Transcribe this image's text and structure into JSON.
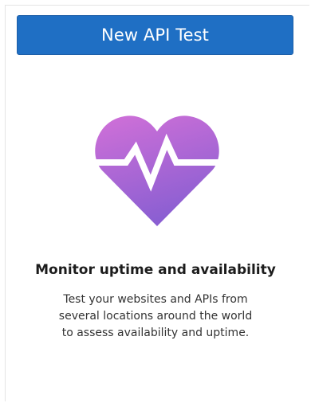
{
  "card": {
    "button_label": "New API Test",
    "icon": "heart-pulse-icon",
    "headline": "Monitor uptime and availability",
    "description_lines": [
      "Test your websites and APIs from",
      "several locations around the world",
      "to assess availability and uptime."
    ]
  },
  "colors": {
    "button": "#1f6fc4",
    "heart_top": "#d170d8",
    "heart_bottom": "#8b5fd2"
  }
}
